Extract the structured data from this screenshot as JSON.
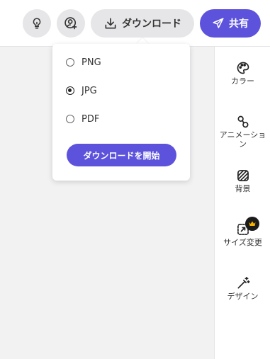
{
  "toolbar": {
    "download_label": "ダウンロード",
    "share_label": "共有",
    "accent_color": "#5c52dc"
  },
  "download_menu": {
    "options": [
      {
        "label": "PNG",
        "selected": false
      },
      {
        "label": "JPG",
        "selected": true
      },
      {
        "label": "PDF",
        "selected": false
      }
    ],
    "start_label": "ダウンロードを開始"
  },
  "sidebar": {
    "items": [
      {
        "label": "カラー",
        "icon": "palette-icon"
      },
      {
        "label": "アニメーション",
        "icon": "animation-icon"
      },
      {
        "label": "背景",
        "icon": "background-icon"
      },
      {
        "label": "サイズ変更",
        "icon": "resize-icon",
        "badge": "crown-icon"
      },
      {
        "label": "デザイン",
        "icon": "magic-wand-icon"
      }
    ]
  }
}
